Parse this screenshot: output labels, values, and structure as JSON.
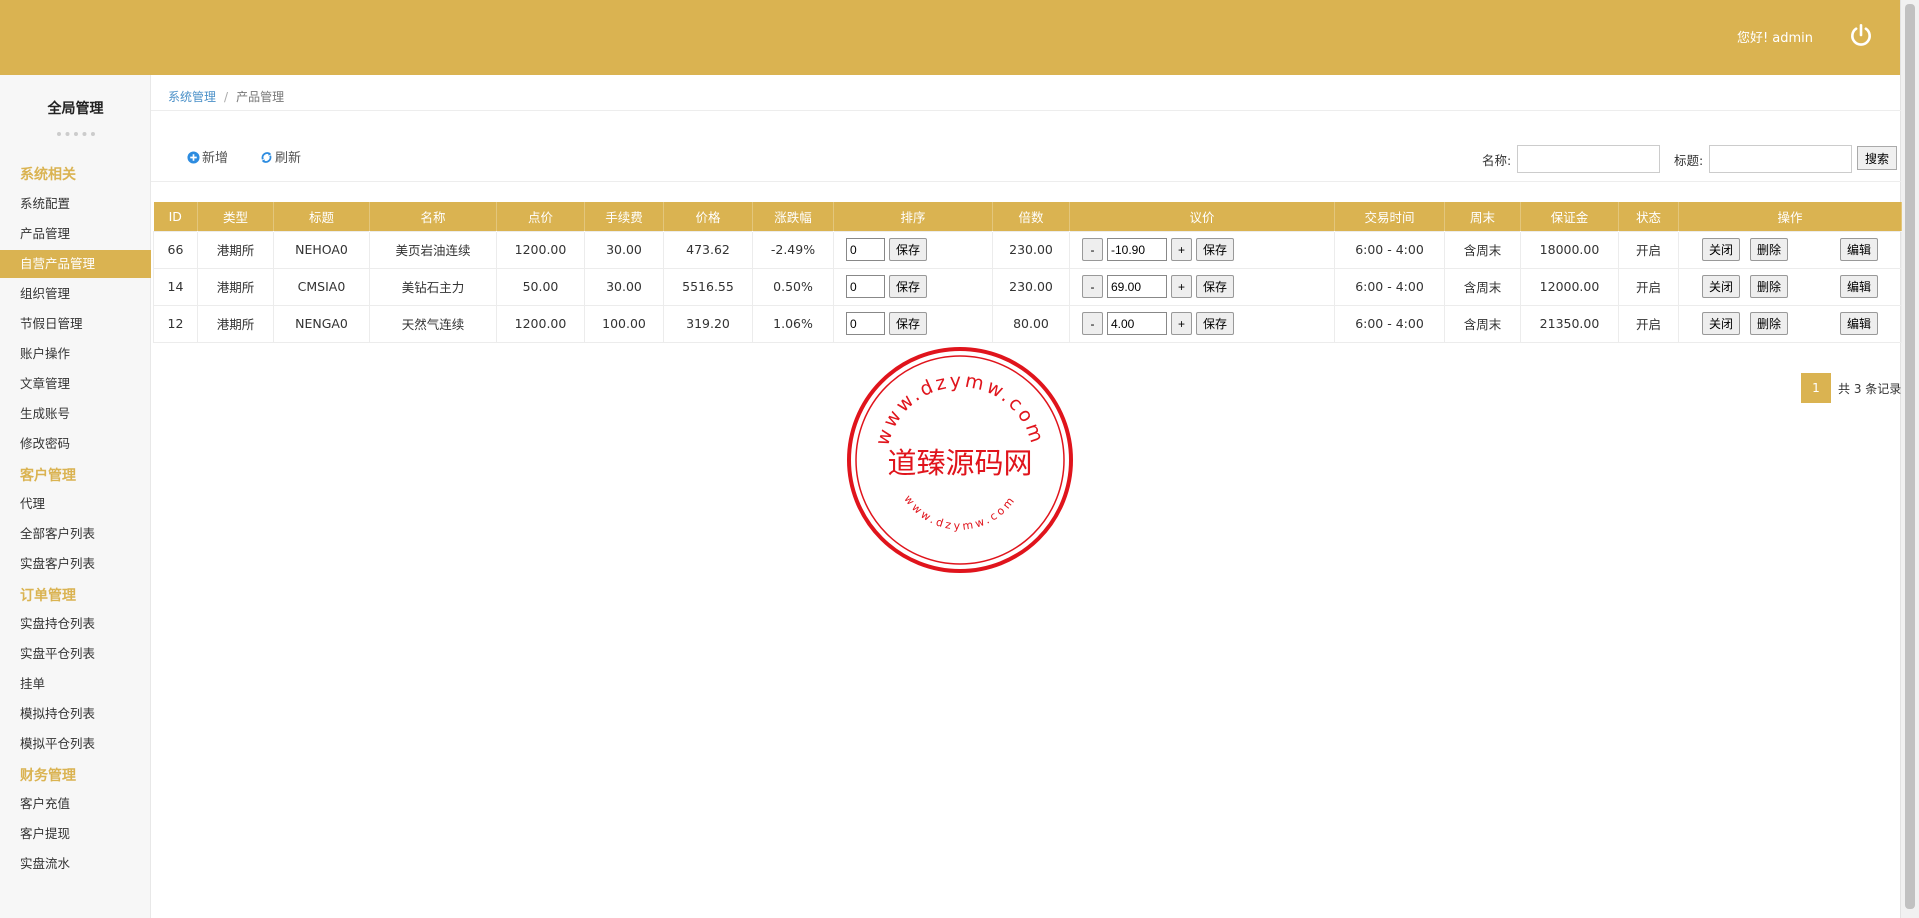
{
  "header": {
    "greeting": "您好!",
    "username": "admin"
  },
  "sidebar": {
    "title": "全局管理",
    "sections": [
      {
        "label": "系统相关",
        "items": [
          "系统配置",
          "产品管理",
          "自营产品管理",
          "组织管理",
          "节假日管理",
          "账户操作",
          "文章管理",
          "生成账号",
          "修改密码"
        ]
      },
      {
        "label": "客户管理",
        "items": [
          "代理",
          "全部客户列表",
          "实盘客户列表"
        ]
      },
      {
        "label": "订单管理",
        "items": [
          "实盘持仓列表",
          "实盘平仓列表",
          "挂单",
          "模拟持仓列表",
          "模拟平仓列表"
        ]
      },
      {
        "label": "财务管理",
        "items": [
          "客户充值",
          "客户提现",
          "实盘流水"
        ]
      }
    ],
    "active_item": "自营产品管理"
  },
  "breadcrumb": {
    "parent": "系统管理",
    "current": "产品管理"
  },
  "toolbar": {
    "add_label": "新增",
    "refresh_label": "刷新",
    "name_label": "名称:",
    "title_label": "标题:",
    "search_label": "搜索",
    "name_value": "",
    "title_value": ""
  },
  "table": {
    "headers": [
      "ID",
      "类型",
      "标题",
      "名称",
      "点价",
      "手续费",
      "价格",
      "涨跌幅",
      "排序",
      "倍数",
      "议价",
      "交易时间",
      "周末",
      "保证金",
      "状态",
      "操作"
    ],
    "rows": [
      {
        "id": "66",
        "type": "港期所",
        "code": "NEHOA0",
        "name": "美页岩油连续",
        "point": "1200.00",
        "fee": "30.00",
        "price": "473.62",
        "change": "-2.49%",
        "sort": "0",
        "multiple": "230.00",
        "bargain": "-10.90",
        "hours": "6:00 - 4:00",
        "weekend": "含周末",
        "margin": "18000.00",
        "status": "开启"
      },
      {
        "id": "14",
        "type": "港期所",
        "code": "CMSIA0",
        "name": "美钻石主力",
        "point": "50.00",
        "fee": "30.00",
        "price": "5516.55",
        "change": "0.50%",
        "sort": "0",
        "multiple": "230.00",
        "bargain": "69.00",
        "hours": "6:00 - 4:00",
        "weekend": "含周末",
        "margin": "12000.00",
        "status": "开启"
      },
      {
        "id": "12",
        "type": "港期所",
        "code": "NENGA0",
        "name": "天然气连续",
        "point": "1200.00",
        "fee": "100.00",
        "price": "319.20",
        "change": "1.06%",
        "sort": "0",
        "multiple": "80.00",
        "bargain": "4.00",
        "hours": "6:00 - 4:00",
        "weekend": "含周末",
        "margin": "21350.00",
        "status": "开启"
      }
    ],
    "actions": {
      "save": "保存",
      "minus": "-",
      "plus": "+",
      "close": "关闭",
      "delete": "删除",
      "edit": "编辑"
    }
  },
  "pagination": {
    "current": "1",
    "total_text": "共 3 条记录"
  },
  "watermark": {
    "text": "道臻源码网",
    "ring_top": "www.dzymw.com",
    "ring_bottom": "www.dzymw.com"
  },
  "colors": {
    "brand": "#dab351",
    "status_open": "#d9251d",
    "link": "#4a90c8",
    "stamp": "#e0141c"
  },
  "icons": {
    "power": "power-icon",
    "add": "plus-circle-icon",
    "refresh": "refresh-icon"
  }
}
